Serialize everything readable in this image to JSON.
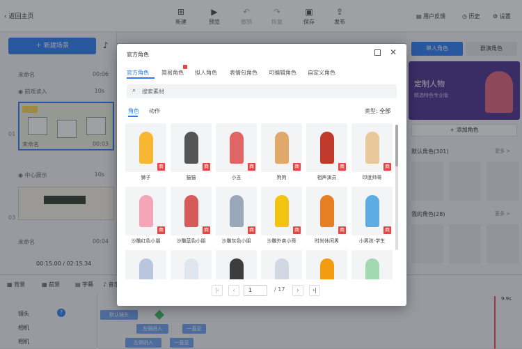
{
  "topbar": {
    "back": "返回主页",
    "tools": [
      {
        "label": "新建",
        "icon": "plus-square-icon"
      },
      {
        "label": "预览",
        "icon": "play-icon"
      },
      {
        "label": "撤销",
        "icon": "undo-icon"
      },
      {
        "label": "恢复",
        "icon": "redo-icon"
      },
      {
        "label": "保存",
        "icon": "save-icon"
      },
      {
        "label": "发布",
        "icon": "publish-icon"
      }
    ],
    "right": [
      {
        "label": "用户反馈",
        "icon": "feedback-icon"
      },
      {
        "label": "历史",
        "icon": "history-icon"
      },
      {
        "label": "设置",
        "icon": "gear-icon"
      }
    ]
  },
  "left": {
    "new_scene": "新建场景",
    "scenes": [
      {
        "name": "未命名",
        "time": "00:06"
      },
      {
        "num": "01",
        "name": "前戏读入",
        "time": "10s",
        "sub_name": "未命名",
        "sub_time": "00:03"
      },
      {
        "num": "02",
        "name": "中心展示",
        "time": "10s"
      },
      {
        "num": "03",
        "name": "未命名",
        "time": "00:04"
      }
    ],
    "time_current": "00:15.00",
    "time_total": "/ 02:15.34"
  },
  "right": {
    "tabs": [
      "单人角色",
      "群演角色"
    ],
    "banner_title": "定制人物",
    "banner_sub": "精选特色专业版",
    "add_role": "+ 添加角色",
    "section1": "默认角色(301)",
    "section2": "我的角色(28)",
    "more": "更多 >"
  },
  "modal": {
    "title": "官方角色",
    "tabs": [
      "官方角色",
      "简易角色",
      "拟人角色",
      "表情包角色",
      "可编辑角色",
      "自定义角色"
    ],
    "search_placeholder": "搜索素材",
    "subtabs": [
      "角色",
      "动作"
    ],
    "filter_label": "类型:",
    "filter_value": "全部",
    "items": [
      "狮子",
      "猫猫",
      "小丑",
      "狗狗",
      "相声演员",
      "印度帅哥",
      "沙雕红色小朋",
      "沙雕蓝色小朋",
      "沙雕灰色小朋",
      "沙雕外卖小哥",
      "时尚休闲男",
      "小男孩-学生",
      "",
      "",
      "",
      "",
      "",
      ""
    ],
    "page_current": "1",
    "page_total": "/ 17"
  },
  "timeline": {
    "tools": [
      "背景",
      "前景",
      "字幕",
      "音乐"
    ],
    "tracks": [
      "镜头",
      "相机",
      "相机"
    ],
    "clips": [
      "默认镜头",
      "左侧进入",
      "一直显",
      "左侧进入",
      "一直显"
    ],
    "end_time": "9.9s"
  },
  "colors": {
    "accent": "#2a7bf4",
    "badge": "#e64545",
    "banner": "#4a2c8f"
  }
}
